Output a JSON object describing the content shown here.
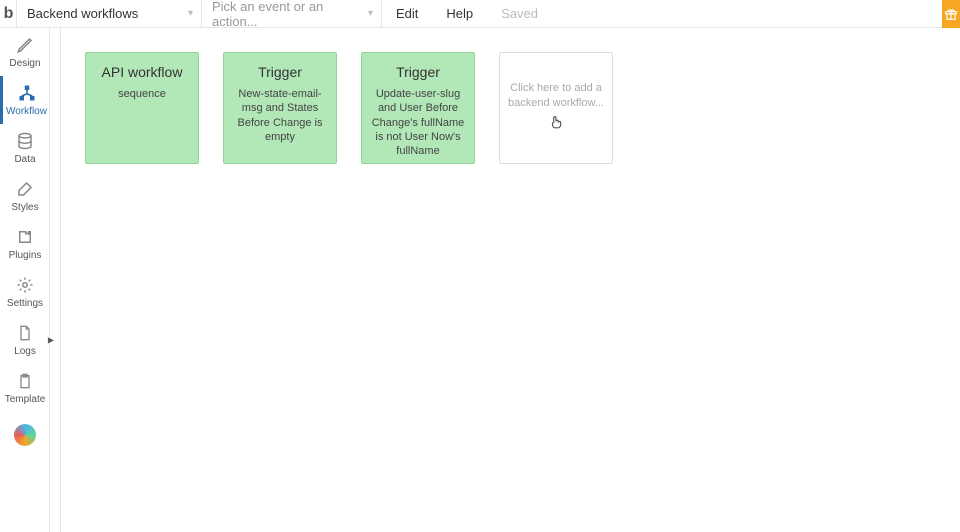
{
  "topbar": {
    "logo_letter": "b",
    "page_dropdown": "Backend workflows",
    "event_dropdown": "Pick an event or an action...",
    "edit": "Edit",
    "help": "Help",
    "saved": "Saved"
  },
  "sidebar": {
    "design": "Design",
    "workflow": "Workflow",
    "data": "Data",
    "styles": "Styles",
    "plugins": "Plugins",
    "settings": "Settings",
    "logs": "Logs",
    "template": "Template"
  },
  "cards": [
    {
      "title": "API workflow",
      "sub": "sequence"
    },
    {
      "title": "Trigger",
      "sub": "New-state-email-msg and States Before Change is empty"
    },
    {
      "title": "Trigger",
      "sub": "Update-user-slug and User Before Change's fullName is not User Now's fullName"
    }
  ],
  "placeholder_card": "Click here to add a backend workflow..."
}
